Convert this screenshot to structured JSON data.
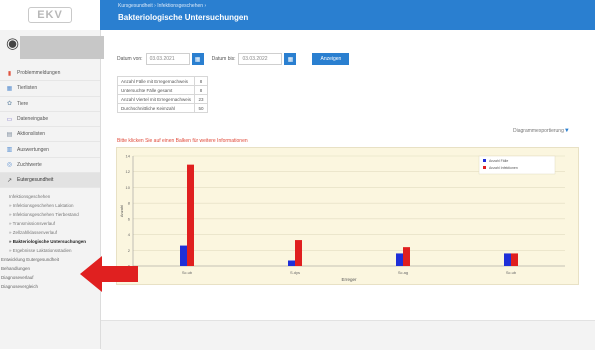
{
  "header": {
    "logo": "EKV",
    "breadcrumb": "Kursgesundheit › Infektionsgeschehen ›",
    "title": "Bakteriologische Untersuchungen"
  },
  "sidebar": {
    "items": [
      {
        "icon": "chart-icon",
        "glyph": "▮",
        "color": "#e0533f",
        "label": "Problemmeldungen"
      },
      {
        "icon": "table-icon",
        "glyph": "▦",
        "color": "#5a8fd0",
        "label": "Tierlisten"
      },
      {
        "icon": "paw-icon",
        "glyph": "✿",
        "color": "#8aa3b8",
        "label": "Tiere"
      },
      {
        "icon": "inbox-icon",
        "glyph": "▭",
        "color": "#7a6fc6",
        "label": "Dateneingabe"
      },
      {
        "icon": "calendar-icon",
        "glyph": "▤",
        "color": "#7a8a9a",
        "label": "Aktionslisten"
      },
      {
        "icon": "report-icon",
        "glyph": "▥",
        "color": "#4f8ad0",
        "label": "Auswertungen"
      },
      {
        "icon": "target-icon",
        "glyph": "◎",
        "color": "#5a8fd0",
        "label": "Zuchtwerte"
      },
      {
        "icon": "health-icon",
        "glyph": "↗",
        "color": "#555555",
        "label": "Eutergesundheit"
      }
    ],
    "active_index": 7,
    "submenu_title": "Infektionsgeschehen",
    "submenu": [
      "» Infektionsgeschehen Laktation",
      "» Infektionsgeschehen Tierbestand",
      "» Transmissionsverlauf",
      "» Zellzahlklassenverlauf",
      "» Bakteriologische Untersuchungen",
      "» Ergebnisse Laktationsstadien"
    ],
    "current_submenu": 4,
    "more": [
      "Entwicklung Eutergesundheit",
      "Behandlungen",
      "Diagnoseverlauf",
      "Diagnosevergleich"
    ]
  },
  "filters": {
    "from_label": "Datum von:",
    "from_value": "03.03.2021",
    "to_label": "Datum bis:",
    "to_value": "03.03.2022",
    "button": "Anzeigen"
  },
  "stats": [
    {
      "label": "Anzahl Fälle mit Erregernachweis",
      "value": "8"
    },
    {
      "label": "Untersuchte Fälle gesamt",
      "value": "8"
    },
    {
      "label": "Anzahl Viertel mit Erregernachweis",
      "value": "23"
    },
    {
      "label": "Durchschnittliche Keimzahl",
      "value": "50"
    }
  ],
  "export_label": "Diagrammexportierung",
  "hint": "Bitte klicken Sie auf einen Balken für weitere Informationen",
  "chart_data": {
    "type": "bar",
    "categories": [
      "Sc.ub",
      "S.dys",
      "Sc.ag",
      "Sc.ub"
    ],
    "series": [
      {
        "name": "Anzahl Fälle",
        "color": "#1f2fd8",
        "values": [
          2.6,
          0.7,
          1.6,
          1.6
        ]
      },
      {
        "name": "Anzahl Infektionen",
        "color": "#e01f1f",
        "values": [
          12.9,
          3.3,
          2.4,
          1.6
        ]
      }
    ],
    "ylim": [
      0,
      14
    ],
    "yticks": [
      0,
      2,
      4,
      6,
      8,
      10,
      12,
      14
    ],
    "xlabel": "Erreger",
    "ylabel": "Anzahl",
    "grid": true,
    "legend": "top-right"
  }
}
